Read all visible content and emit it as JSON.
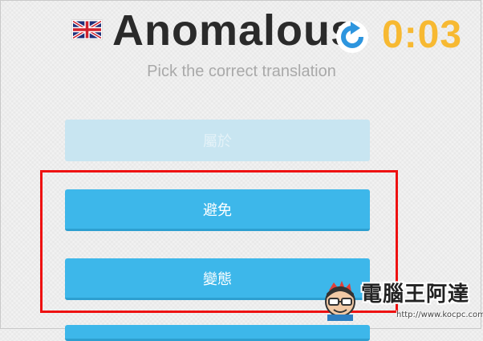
{
  "header": {
    "flag_icon": "uk-flag-icon",
    "word": "Anomalous",
    "replay_icon": "replay-icon",
    "timer": "0:03"
  },
  "prompt": {
    "subtitle": "Pick the correct translation"
  },
  "answers": [
    {
      "label": "屬於",
      "state": "disabled"
    },
    {
      "label": "避免",
      "state": "active"
    },
    {
      "label": "變態",
      "state": "active"
    },
    {
      "label": "",
      "state": "active"
    }
  ],
  "colors": {
    "background": "#f2f2f2",
    "word": "#2a2a2a",
    "timer": "#f7b932",
    "replay": "#2d95de",
    "answer_active": "#3db7ea",
    "answer_disabled": "#c8e5f1",
    "highlight": "#ee1111",
    "subtitle": "#a9a9a9"
  },
  "watermark": {
    "brand": "電腦王阿達",
    "url": "http://www.kocpc.com.tw",
    "mascot_icon": "mascot-icon"
  }
}
